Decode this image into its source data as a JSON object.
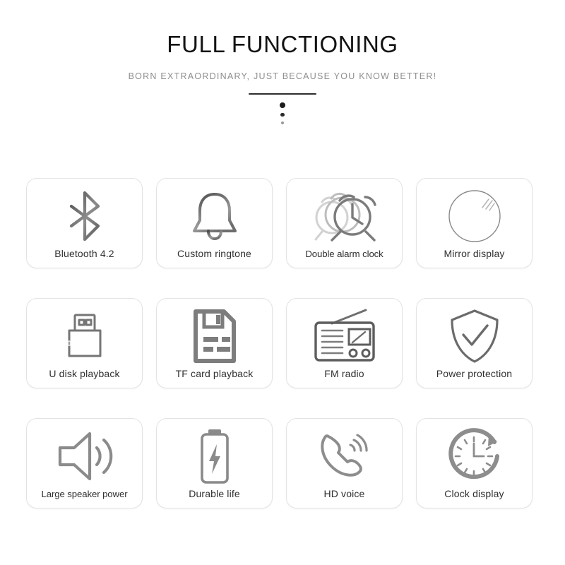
{
  "header": {
    "title": "FULL FUNCTIONING",
    "subtitle": "BORN EXTRAORDINARY, JUST BECAUSE YOU KNOW BETTER!",
    "divider": {
      "line_color": "#2e2e2e",
      "dot_count": 3
    }
  },
  "colors": {
    "background": "#ffffff",
    "title_text": "#131313",
    "subtitle_text": "#8e8e8e",
    "label_text": "#2f2f2f",
    "card_border": "#e3e3e3",
    "icon_dark": "#5a5a5a",
    "icon_light": "#c9c9c9"
  },
  "features": [
    {
      "label": "Bluetooth 4.2",
      "icon": "bluetooth-icon"
    },
    {
      "label": "Custom ringtone",
      "icon": "bell-icon"
    },
    {
      "label": "Double alarm clock",
      "icon": "double-alarm-clock-icon"
    },
    {
      "label": "Mirror display",
      "icon": "mirror-circle-icon"
    },
    {
      "label": "U disk playback",
      "icon": "usb-drive-icon"
    },
    {
      "label": "TF card playback",
      "icon": "memory-card-icon"
    },
    {
      "label": "FM radio",
      "icon": "radio-icon"
    },
    {
      "label": "Power protection",
      "icon": "shield-check-icon"
    },
    {
      "label": "Large speaker power",
      "icon": "speaker-waves-icon"
    },
    {
      "label": "Durable life",
      "icon": "battery-bolt-icon"
    },
    {
      "label": "HD voice",
      "icon": "phone-handset-waves-icon"
    },
    {
      "label": "Clock display",
      "icon": "clock-arrow-icon"
    }
  ]
}
